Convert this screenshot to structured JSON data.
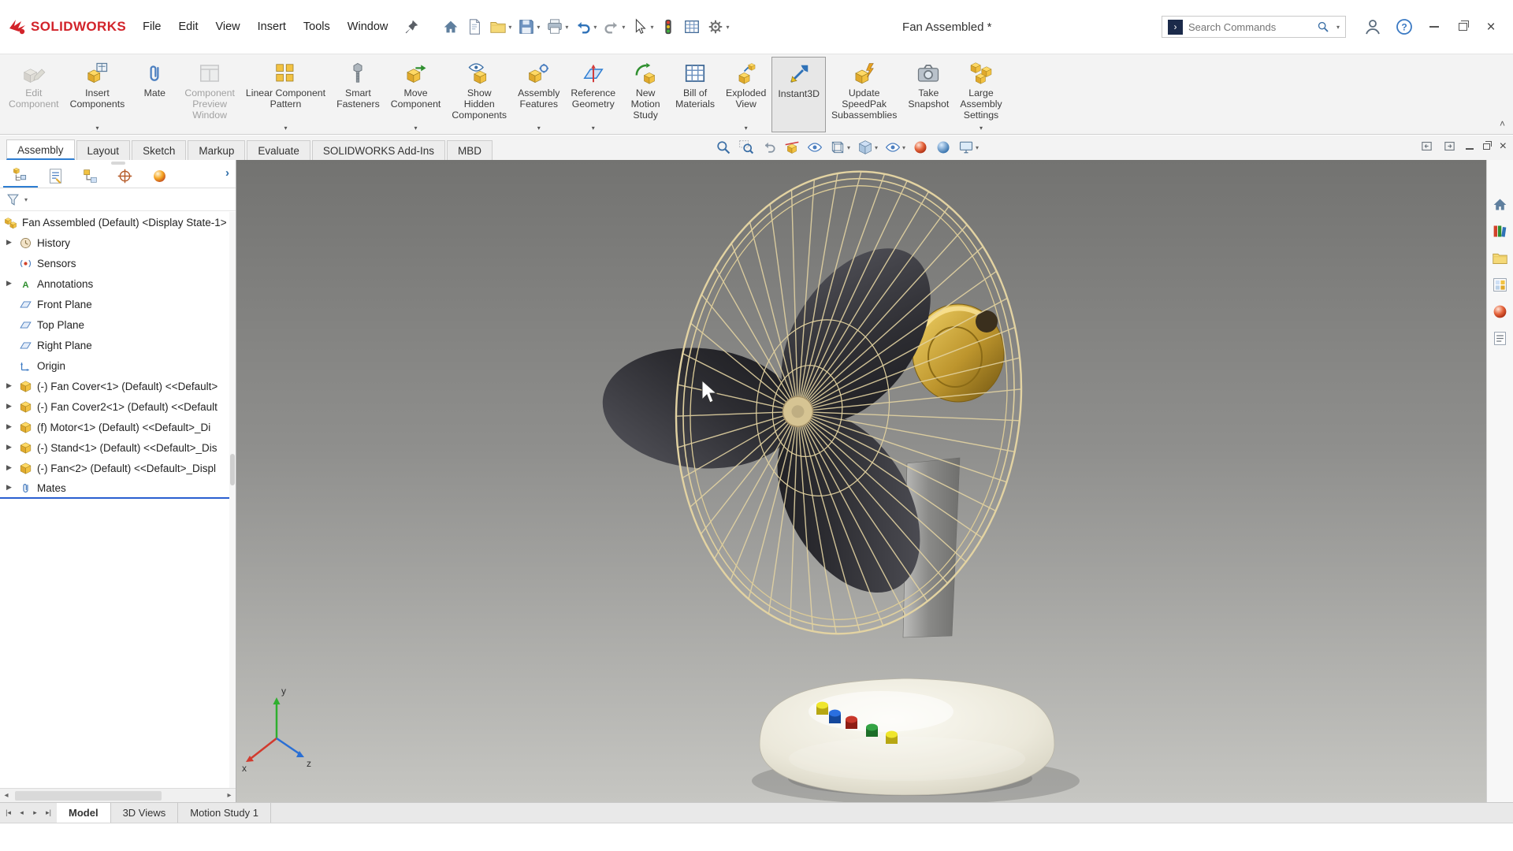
{
  "titlebar": {
    "brand": "SOLIDWORKS",
    "menus": [
      "File",
      "Edit",
      "View",
      "Insert",
      "Tools",
      "Window"
    ],
    "quick_access_icons": [
      "home",
      "new-document",
      "open",
      "save",
      "print",
      "undo",
      "redo",
      "select",
      "rebuild",
      "file-properties",
      "options"
    ],
    "document_title": "Fan Assembled *",
    "search": {
      "placeholder": "Search Commands"
    }
  },
  "ribbon": {
    "buttons": [
      {
        "label": "Edit\nComponent",
        "state": "disabled",
        "caret": false
      },
      {
        "label": "Insert\nComponents",
        "state": "normal",
        "caret": true
      },
      {
        "label": "Mate",
        "state": "normal",
        "caret": false
      },
      {
        "label": "Component\nPreview\nWindow",
        "state": "disabled",
        "caret": false
      },
      {
        "label": "Linear Component\nPattern",
        "state": "normal",
        "caret": true
      },
      {
        "label": "Smart\nFasteners",
        "state": "normal",
        "caret": false
      },
      {
        "label": "Move\nComponent",
        "state": "normal",
        "caret": true
      },
      {
        "label": "Show\nHidden\nComponents",
        "state": "normal",
        "caret": false
      },
      {
        "label": "Assembly\nFeatures",
        "state": "normal",
        "caret": true
      },
      {
        "label": "Reference\nGeometry",
        "state": "normal",
        "caret": true
      },
      {
        "label": "New\nMotion\nStudy",
        "state": "normal",
        "caret": false
      },
      {
        "label": "Bill of\nMaterials",
        "state": "normal",
        "caret": false
      },
      {
        "label": "Exploded\nView",
        "state": "normal",
        "caret": true
      },
      {
        "label": "Instant3D",
        "state": "active",
        "caret": false
      },
      {
        "label": "Update\nSpeedPak\nSubassemblies",
        "state": "normal",
        "caret": false
      },
      {
        "label": "Take\nSnapshot",
        "state": "normal",
        "caret": false
      },
      {
        "label": "Large\nAssembly\nSettings",
        "state": "normal",
        "caret": true
      }
    ]
  },
  "command_tabs": {
    "items": [
      "Assembly",
      "Layout",
      "Sketch",
      "Markup",
      "Evaluate",
      "SOLIDWORKS Add-Ins",
      "MBD"
    ],
    "active_index": 0
  },
  "headsup_icons": [
    "zoom-to-fit",
    "zoom-to-area",
    "previous-view",
    "section-view",
    "dynamic-annotation-views",
    "display-style",
    "hide-show-items",
    "view-orientation",
    "edit-appearance",
    "apply-scene",
    "view-settings"
  ],
  "feature_tree": {
    "items": [
      {
        "label": "Fan Assembled (Default) <Display State-1>",
        "icon": "assembly",
        "arrow": false,
        "selected": false
      },
      {
        "label": "History",
        "icon": "history",
        "arrow": true,
        "selected": false
      },
      {
        "label": "Sensors",
        "icon": "sensors",
        "arrow": false,
        "selected": false
      },
      {
        "label": "Annotations",
        "icon": "annotations",
        "arrow": true,
        "selected": false
      },
      {
        "label": "Front Plane",
        "icon": "plane",
        "arrow": false,
        "selected": false
      },
      {
        "label": "Top Plane",
        "icon": "plane",
        "arrow": false,
        "selected": false
      },
      {
        "label": "Right Plane",
        "icon": "plane",
        "arrow": false,
        "selected": false
      },
      {
        "label": "Origin",
        "icon": "origin",
        "arrow": false,
        "selected": false
      },
      {
        "label": "(-) Fan Cover<1> (Default) <<Default>",
        "icon": "part",
        "arrow": true,
        "selected": false
      },
      {
        "label": "(-) Fan Cover2<1> (Default) <<Default",
        "icon": "part",
        "arrow": true,
        "selected": false
      },
      {
        "label": "(f) Motor<1> (Default) <<Default>_Di",
        "icon": "part",
        "arrow": true,
        "selected": false
      },
      {
        "label": "(-) Stand<1> (Default) <<Default>_Dis",
        "icon": "part",
        "arrow": true,
        "selected": false
      },
      {
        "label": "(-) Fan<2> (Default) <<Default>_Displ",
        "icon": "part",
        "arrow": true,
        "selected": false
      },
      {
        "label": "Mates",
        "icon": "mates",
        "arrow": true,
        "selected": true
      }
    ]
  },
  "viewport": {
    "triad": [
      "x",
      "y",
      "z"
    ]
  },
  "task_pane_icons": [
    "solidworks-resources",
    "design-library",
    "file-explorer",
    "view-palette",
    "appearances-scenes",
    "custom-properties"
  ],
  "document_tabs": {
    "items": [
      "Model",
      "3D Views",
      "Motion Study 1"
    ],
    "active_index": 0
  },
  "colors": {
    "brand_red": "#d2232a",
    "selection_blue": "#2a5fd0",
    "viewport_top": "#737371",
    "viewport_bottom": "#c4c4c0",
    "cage_cream": "#e3d3a2",
    "motor_gold": "#c9a227"
  }
}
